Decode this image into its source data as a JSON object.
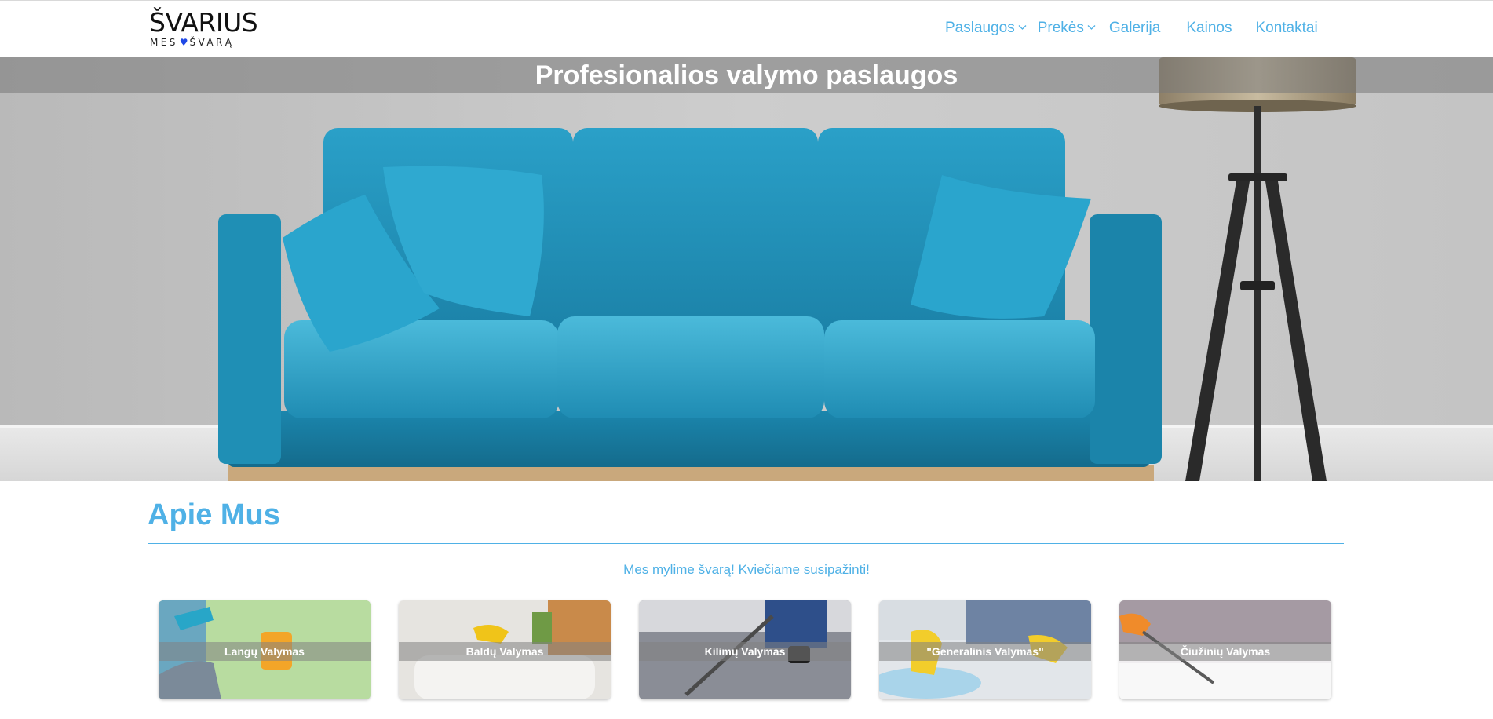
{
  "brand": {
    "name": "ŠVARIUS",
    "tagline_left": "MES",
    "tagline_right": "ŠVARĄ",
    "heart_icon": "heart-icon",
    "heart_color": "#1f48e6"
  },
  "nav": {
    "items": [
      {
        "label": "Paslaugos",
        "has_dropdown": true
      },
      {
        "label": "Prekės",
        "has_dropdown": true
      },
      {
        "label": "Galerija",
        "has_dropdown": false
      },
      {
        "label": "Kainos",
        "has_dropdown": false
      },
      {
        "label": "Kontaktai",
        "has_dropdown": false
      }
    ],
    "color": "#4fb1e6"
  },
  "hero": {
    "title": "Profesionalios valymo paslaugos"
  },
  "about": {
    "title": "Apie Mus",
    "subtitle": "Mes mylime švarą! Kviečiame susipažinti!"
  },
  "services": [
    {
      "label": "Langų Valymas"
    },
    {
      "label": "Baldų Valymas"
    },
    {
      "label": "Kilimų Valymas"
    },
    {
      "label": "\"Generalinis Valymas\""
    },
    {
      "label": "Čiužinių Valymas"
    }
  ],
  "colors": {
    "accent": "#4fb1e6",
    "sofa": "#1f8fb5"
  }
}
